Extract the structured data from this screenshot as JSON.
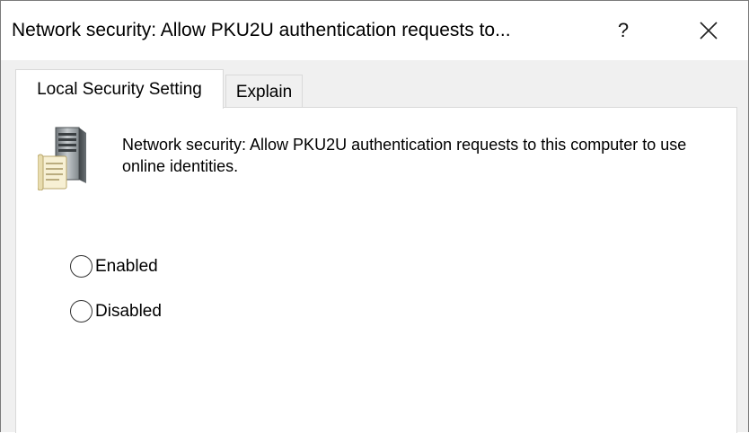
{
  "window": {
    "title": "Network security: Allow PKU2U authentication requests to...",
    "help_label": "?",
    "close_icon": "close-icon"
  },
  "tabs": [
    {
      "label": "Local Security Setting",
      "active": true
    },
    {
      "label": "Explain",
      "active": false
    }
  ],
  "policy": {
    "icon": "policy-server-icon",
    "description": "Network security: Allow PKU2U authentication requests to this computer to use online identities."
  },
  "options": [
    {
      "label": "Enabled",
      "selected": false
    },
    {
      "label": "Disabled",
      "selected": false
    }
  ],
  "colors": {
    "window_bg": "#f0f0f0",
    "content_bg": "#ffffff",
    "border": "#d9d9d9"
  }
}
